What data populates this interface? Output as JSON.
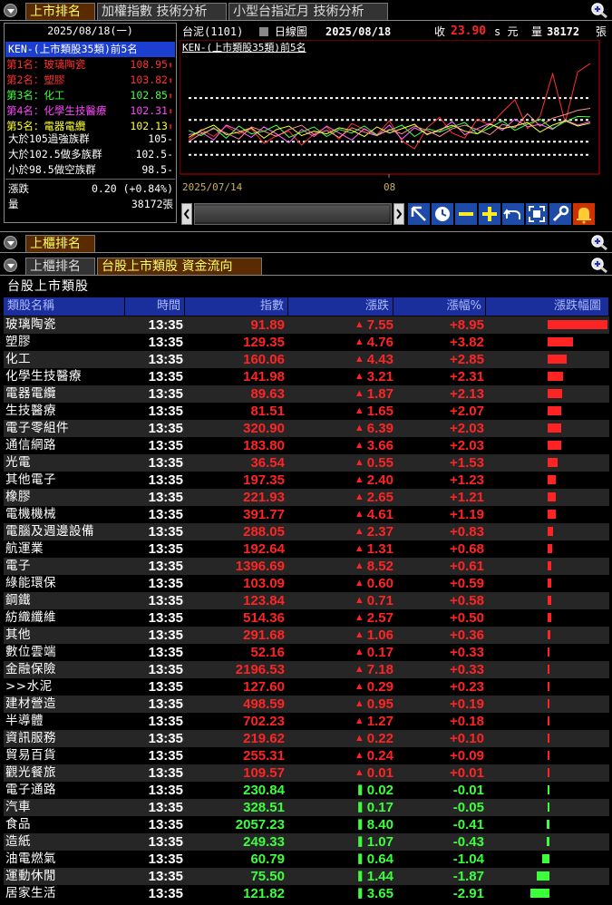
{
  "top_tabs": [
    "上市排名",
    "加權指數 技術分析",
    "小型台指近月 技術分析"
  ],
  "left_panel": {
    "date": "2025/08/18(一)",
    "header": "KEN-(上市類股35類)前5名",
    "ranks": [
      {
        "label": "第1名：玻璃陶瓷",
        "value": "108.95",
        "color": "#ff3030"
      },
      {
        "label": "第2名：塑膠",
        "value": "103.82",
        "color": "#ff3030"
      },
      {
        "label": "第3名：化工",
        "value": "102.85",
        "color": "#44ff44"
      },
      {
        "label": "第4名：化學生技醫療",
        "value": "102.31",
        "color": "#ff44ff"
      },
      {
        "label": "第5名：電器電纜",
        "value": "102.13",
        "color": "#ffff33"
      }
    ],
    "stats": [
      {
        "label": "大於105過強族群",
        "value": "105-"
      },
      {
        "label": "大於102.5做多族群",
        "value": "102.5-"
      },
      {
        "label": "小於98.5做空族群",
        "value": "98.5-"
      }
    ],
    "change_label": "漲跌",
    "change_value": "0.20 (+0.84%)",
    "volume_label": "量",
    "volume_value": "38172張"
  },
  "chart_header": {
    "stock": "台泥(1101)",
    "chart_type": "日線圖",
    "date": "2025/08/18",
    "close_label": "收",
    "close_value": "23.90",
    "unit_suffix": "s 元",
    "volume_label": "量",
    "volume_value": "38172",
    "volume_unit": "張"
  },
  "chart_data": {
    "type": "line",
    "title": "KEN-(上市類股35類)前5名",
    "x_labels": [
      "2025/07/14",
      "08"
    ],
    "reference_levels": [
      105,
      102.5,
      100,
      98.5
    ],
    "series": [
      {
        "color": "#ff3030",
        "values": [
          100.2,
          101.4,
          100.6,
          101.8,
          100.9,
          101.5,
          99.8,
          100.7,
          101.2,
          99.6,
          100.9,
          101.7,
          100.3,
          102.1,
          101.4,
          100.8,
          102.4,
          100.1,
          99.2,
          101.6,
          102.8,
          101.0,
          100.4,
          102.6,
          101.9,
          103.4,
          104.8,
          101.5,
          102.9,
          107.8,
          102.2,
          108.0,
          108.95
        ]
      },
      {
        "color": "#ff66ff",
        "values": [
          100.8,
          101.1,
          100.2,
          101.9,
          101.3,
          100.5,
          101.7,
          100.9,
          99.9,
          101.4,
          100.6,
          101.8,
          101.0,
          100.2,
          101.5,
          100.7,
          101.9,
          100.3,
          101.6,
          100.9,
          101.2,
          102.3,
          100.8,
          101.5,
          102.1,
          101.3,
          102.6,
          101.7,
          102.0,
          101.4,
          102.5,
          101.9,
          102.31
        ]
      },
      {
        "color": "#44ff44",
        "values": [
          101.3,
          100.7,
          101.6,
          100.4,
          101.8,
          100.9,
          101.2,
          101.9,
          100.5,
          101.1,
          101.7,
          100.6,
          101.4,
          101.0,
          101.8,
          100.8,
          101.3,
          101.9,
          100.6,
          101.5,
          101.1,
          101.7,
          102.2,
          100.9,
          101.6,
          102.4,
          101.3,
          102.0,
          102.6,
          101.5,
          102.3,
          102.9,
          102.85
        ]
      },
      {
        "color": "#ffff33",
        "values": [
          100.5,
          101.3,
          101.9,
          100.8,
          101.1,
          101.6,
          100.4,
          101.4,
          101.8,
          100.7,
          101.2,
          100.9,
          101.6,
          101.3,
          100.6,
          101.7,
          101.0,
          101.5,
          102.0,
          100.8,
          101.4,
          101.9,
          101.2,
          100.9,
          102.0,
          101.5,
          101.8,
          102.2,
          101.1,
          101.9,
          102.4,
          101.8,
          102.13
        ]
      },
      {
        "color": "#ff9090",
        "values": [
          100.0,
          100.9,
          101.5,
          101.0,
          100.3,
          101.7,
          101.2,
          100.6,
          101.4,
          101.9,
          100.8,
          101.3,
          100.5,
          101.6,
          101.1,
          100.7,
          101.4,
          100.9,
          101.8,
          101.3,
          100.6,
          101.5,
          101.9,
          101.4,
          100.8,
          102.0,
          101.6,
          103.2,
          101.8,
          102.7,
          103.1,
          103.6,
          103.82
        ]
      }
    ],
    "ylim": [
      96.5,
      110
    ]
  },
  "bottom_tabs_1": [
    "上櫃排名"
  ],
  "bottom_tabs_2": [
    "上櫃排名",
    "台股上市類股 資金流向"
  ],
  "table_title": "台股上市類股",
  "columns": [
    "類股名稱",
    "時間",
    "指數",
    "漲跌",
    "漲幅%",
    "漲跌幅圖"
  ],
  "rows": [
    {
      "name": "玻璃陶瓷",
      "time": "13:35",
      "index": "91.89",
      "change": "7.55",
      "pct": "+8.95",
      "pct_num": 8.95
    },
    {
      "name": "塑膠",
      "time": "13:35",
      "index": "129.35",
      "change": "4.76",
      "pct": "+3.82",
      "pct_num": 3.82
    },
    {
      "name": "化工",
      "time": "13:35",
      "index": "160.06",
      "change": "4.43",
      "pct": "+2.85",
      "pct_num": 2.85
    },
    {
      "name": "化學生技醫療",
      "time": "13:35",
      "index": "141.98",
      "change": "3.21",
      "pct": "+2.31",
      "pct_num": 2.31
    },
    {
      "name": "電器電纜",
      "time": "13:35",
      "index": "89.63",
      "change": "1.87",
      "pct": "+2.13",
      "pct_num": 2.13
    },
    {
      "name": "生技醫療",
      "time": "13:35",
      "index": "81.51",
      "change": "1.65",
      "pct": "+2.07",
      "pct_num": 2.07
    },
    {
      "name": "電子零組件",
      "time": "13:35",
      "index": "320.90",
      "change": "6.39",
      "pct": "+2.03",
      "pct_num": 2.03
    },
    {
      "name": "通信網路",
      "time": "13:35",
      "index": "183.80",
      "change": "3.66",
      "pct": "+2.03",
      "pct_num": 2.03
    },
    {
      "name": "光電",
      "time": "13:35",
      "index": "36.54",
      "change": "0.55",
      "pct": "+1.53",
      "pct_num": 1.53
    },
    {
      "name": "其他電子",
      "time": "13:35",
      "index": "197.35",
      "change": "2.40",
      "pct": "+1.23",
      "pct_num": 1.23
    },
    {
      "name": "橡膠",
      "time": "13:35",
      "index": "221.93",
      "change": "2.65",
      "pct": "+1.21",
      "pct_num": 1.21
    },
    {
      "name": "電機機械",
      "time": "13:35",
      "index": "391.77",
      "change": "4.61",
      "pct": "+1.19",
      "pct_num": 1.19
    },
    {
      "name": "電腦及週邊設備",
      "time": "13:35",
      "index": "288.05",
      "change": "2.37",
      "pct": "+0.83",
      "pct_num": 0.83
    },
    {
      "name": "航運業",
      "time": "13:35",
      "index": "192.64",
      "change": "1.31",
      "pct": "+0.68",
      "pct_num": 0.68
    },
    {
      "name": "電子",
      "time": "13:35",
      "index": "1396.69",
      "change": "8.52",
      "pct": "+0.61",
      "pct_num": 0.61
    },
    {
      "name": "綠能環保",
      "time": "13:35",
      "index": "103.09",
      "change": "0.60",
      "pct": "+0.59",
      "pct_num": 0.59
    },
    {
      "name": "鋼鐵",
      "time": "13:35",
      "index": "123.84",
      "change": "0.71",
      "pct": "+0.58",
      "pct_num": 0.58
    },
    {
      "name": "紡織纖維",
      "time": "13:35",
      "index": "514.36",
      "change": "2.57",
      "pct": "+0.50",
      "pct_num": 0.5
    },
    {
      "name": "其他",
      "time": "13:35",
      "index": "291.68",
      "change": "1.06",
      "pct": "+0.36",
      "pct_num": 0.36
    },
    {
      "name": "數位雲端",
      "time": "13:35",
      "index": "52.16",
      "change": "0.17",
      "pct": "+0.33",
      "pct_num": 0.33
    },
    {
      "name": "金融保險",
      "time": "13:35",
      "index": "2196.53",
      "change": "7.18",
      "pct": "+0.33",
      "pct_num": 0.33
    },
    {
      "name": ">>水泥",
      "time": "13:35",
      "index": "127.60",
      "change": "0.29",
      "pct": "+0.23",
      "pct_num": 0.23
    },
    {
      "name": "建材營造",
      "time": "13:35",
      "index": "498.59",
      "change": "0.95",
      "pct": "+0.19",
      "pct_num": 0.19
    },
    {
      "name": "半導體",
      "time": "13:35",
      "index": "702.23",
      "change": "1.27",
      "pct": "+0.18",
      "pct_num": 0.18
    },
    {
      "name": "資訊服務",
      "time": "13:35",
      "index": "219.62",
      "change": "0.22",
      "pct": "+0.10",
      "pct_num": 0.1
    },
    {
      "name": "貿易百貨",
      "time": "13:35",
      "index": "255.31",
      "change": "0.24",
      "pct": "+0.09",
      "pct_num": 0.09
    },
    {
      "name": "觀光餐旅",
      "time": "13:35",
      "index": "109.57",
      "change": "0.01",
      "pct": "+0.01",
      "pct_num": 0.01
    },
    {
      "name": "電子通路",
      "time": "13:35",
      "index": "230.84",
      "change": "0.02",
      "pct": "-0.01",
      "pct_num": -0.01
    },
    {
      "name": "汽車",
      "time": "13:35",
      "index": "328.51",
      "change": "0.17",
      "pct": "-0.05",
      "pct_num": -0.05
    },
    {
      "name": "食品",
      "time": "13:35",
      "index": "2057.23",
      "change": "8.40",
      "pct": "-0.41",
      "pct_num": -0.41
    },
    {
      "name": "造紙",
      "time": "13:35",
      "index": "249.33",
      "change": "1.07",
      "pct": "-0.43",
      "pct_num": -0.43
    },
    {
      "name": "油電燃氣",
      "time": "13:35",
      "index": "60.79",
      "change": "0.64",
      "pct": "-1.04",
      "pct_num": -1.04
    },
    {
      "name": "運動休閒",
      "time": "13:35",
      "index": "75.50",
      "change": "1.44",
      "pct": "-1.87",
      "pct_num": -1.87
    },
    {
      "name": "居家生活",
      "time": "13:35",
      "index": "121.82",
      "change": "3.65",
      "pct": "-2.91",
      "pct_num": -2.91
    }
  ],
  "colors": {
    "up": "#ff2424",
    "down": "#3cff3c",
    "header_bg": "#1a2f9c",
    "active_tab": "#ffff66"
  }
}
